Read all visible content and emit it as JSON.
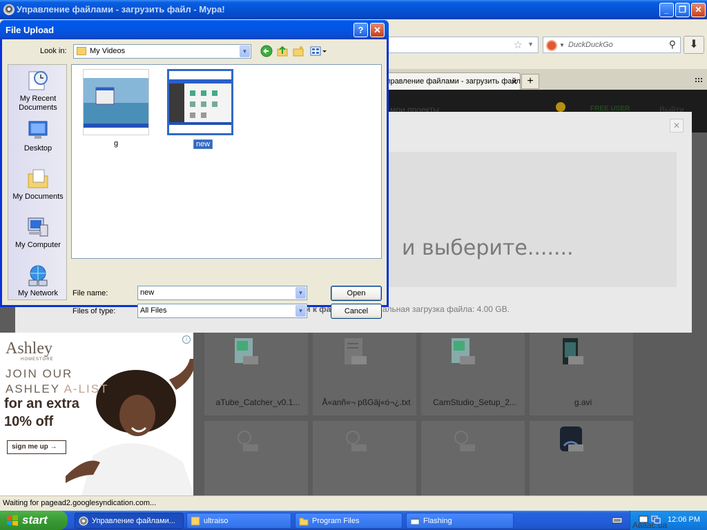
{
  "browser": {
    "title": "Управление файлами - загрузить файл - Мура!",
    "search_placeholder": "DuckDuckGo",
    "tab_label": "Управление файлами - загрузить файл",
    "tab_close": "×",
    "new_tab": "+",
    "status": "Waiting for pagead2.googlesyndication.com..."
  },
  "page": {
    "drop_text": "и выберите.......",
    "settings_link": "Дополнительные настройки к файлу",
    "settings_sep": "|",
    "settings_max": "Максимальная загрузка файла: 4.00 GB.",
    "header_projects": "мои проекты",
    "header_free_user": "FREE USER",
    "header_exit": "Выйти",
    "files": [
      {
        "name": "aTube_Catcher_v0.1...",
        "ext": "EXE"
      },
      {
        "name": "Å«anñ«¬ pßGâj«ó¬¿.txt",
        "ext": "TXT"
      },
      {
        "name": "CamStudio_Setup_2...",
        "ext": "EXE"
      },
      {
        "name": "g.avi",
        "ext": "AVI"
      }
    ],
    "files_row2": [
      {
        "ext": "..."
      },
      {
        "ext": "..."
      },
      {
        "ext": "..."
      },
      {
        "ext": "BAT"
      }
    ]
  },
  "ad": {
    "brand": "Ashley",
    "sub": "HOMESTORE",
    "line1": "JOIN OUR",
    "line2a": "ASHLEY",
    "line2b": " A-LIST",
    "line3": "for an extra",
    "line4": "10% off",
    "cta": "sign me up →",
    "info": "i"
  },
  "dialog": {
    "title": "File Upload",
    "help": "?",
    "close": "✕",
    "look_in_label": "Look in:",
    "look_in_value": "My Videos",
    "places": [
      "My Recent Documents",
      "Desktop",
      "My Documents",
      "My Computer",
      "My Network"
    ],
    "items": [
      {
        "label": "g"
      },
      {
        "label": "new"
      }
    ],
    "file_name_label": "File name:",
    "file_name_value": "new",
    "files_type_label": "Files of type:",
    "files_type_value": "All Files",
    "open_label": "Open",
    "cancel_label": "Cancel"
  },
  "taskbar": {
    "start": "start",
    "tasks": [
      "Управление файлами...",
      "ultraiso",
      "Program Files",
      "Flashing"
    ],
    "clock": "12:06 PM",
    "watermark": "Аваас.ua"
  },
  "colors": {
    "xp_blue": "#0553d6",
    "selection": "#316ac5",
    "start_green": "#3c9f37"
  }
}
